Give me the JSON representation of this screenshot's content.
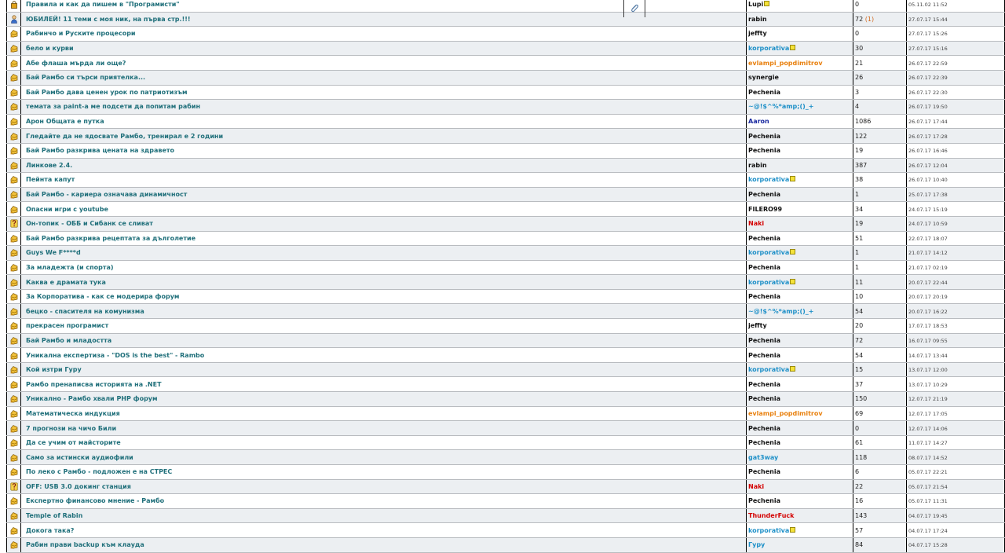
{
  "colors": {
    "title_link": "#1f6f7a",
    "row_alt": "#eceff2",
    "author_default": "#111111",
    "author_blue": "#1e90c8",
    "author_orange": "#e8800e",
    "author_red": "#d40000",
    "author_navy": "#1a2aa0"
  },
  "topics": [
    {
      "icon": "lock-icon",
      "title": "Правила и как да пишем в \"Програмисти\"",
      "author": "Lupi",
      "author_color": "#111111",
      "badge": true,
      "replies": "0",
      "new_replies": "",
      "date": "05.11.02 11:52"
    },
    {
      "icon": "user-icon",
      "title": "ЮБИЛЕЙ! 11 теми с моя ник, на първа стр.!!!",
      "author": "rabin",
      "author_color": "#111111",
      "badge": false,
      "replies": "72",
      "new_replies": "(1)",
      "date": "27.07.17 15:44"
    },
    {
      "icon": "thread-icon",
      "title": "Рабинчо и Руските процесори",
      "author": "jeffty",
      "author_color": "#111111",
      "badge": false,
      "replies": "0",
      "new_replies": "",
      "date": "27.07.17 15:26"
    },
    {
      "icon": "thread-icon",
      "title": "бело и курви",
      "author": "korporativa",
      "author_color": "#1e90c8",
      "badge": true,
      "replies": "30",
      "new_replies": "",
      "date": "27.07.17 15:16"
    },
    {
      "icon": "thread-icon",
      "title": "Абе флаша мърда ли още?",
      "author": "evlampi_popdimitrov",
      "author_color": "#e8800e",
      "badge": false,
      "replies": "21",
      "new_replies": "",
      "date": "26.07.17 22:59"
    },
    {
      "icon": "thread-icon",
      "title": "Бай Рамбо си търси приятелка...",
      "author": "synergie",
      "author_color": "#111111",
      "badge": false,
      "replies": "26",
      "new_replies": "",
      "date": "26.07.17 22:39"
    },
    {
      "icon": "thread-icon",
      "title": "Бай Рамбо дава ценен урок по патриотизъм",
      "author": "Pechenia",
      "author_color": "#111111",
      "badge": false,
      "replies": "3",
      "new_replies": "",
      "date": "26.07.17 22:30"
    },
    {
      "icon": "thread-icon",
      "title": "темата за paint-a ме подсети да попитам рабин",
      "author": "~@!$^%*amp;()_+",
      "author_color": "#1e90c8",
      "badge": false,
      "replies": "4",
      "new_replies": "",
      "date": "26.07.17 19:50"
    },
    {
      "icon": "thread-icon",
      "title": "Арон Общата е путка",
      "author": "Aaron",
      "author_color": "#1a2aa0",
      "badge": false,
      "replies": "1086",
      "new_replies": "",
      "date": "26.07.17 17:44"
    },
    {
      "icon": "thread-icon",
      "title": "Гледайте да не ядосвате Рамбо, тренирал е 2 години",
      "author": "Pechenia",
      "author_color": "#111111",
      "badge": false,
      "replies": "122",
      "new_replies": "",
      "date": "26.07.17 17:28"
    },
    {
      "icon": "thread-icon",
      "title": "Бай Рамбо разкрива цената на здравето",
      "author": "Pechenia",
      "author_color": "#111111",
      "badge": false,
      "replies": "19",
      "new_replies": "",
      "date": "26.07.17 16:46"
    },
    {
      "icon": "thread-icon",
      "title": "Линкове 2.4.",
      "author": "rabin",
      "author_color": "#111111",
      "badge": false,
      "replies": "387",
      "new_replies": "",
      "date": "26.07.17 12:04"
    },
    {
      "icon": "thread-icon",
      "title": "Пейнта капут",
      "author": "korporativa",
      "author_color": "#1e90c8",
      "badge": true,
      "replies": "38",
      "new_replies": "",
      "date": "26.07.17 10:40"
    },
    {
      "icon": "thread-icon",
      "title": "Бай Рамбо - кариера означава динамичност",
      "author": "Pechenia",
      "author_color": "#111111",
      "badge": false,
      "replies": "1",
      "new_replies": "",
      "date": "25.07.17 17:38"
    },
    {
      "icon": "thread-icon",
      "title": "Опасни игри с youtube",
      "author": "FILERO99",
      "author_color": "#111111",
      "badge": false,
      "replies": "34",
      "new_replies": "",
      "date": "24.07.17 15:19"
    },
    {
      "icon": "question-icon",
      "title": "Он-топик - ОББ и Сибанк се сливат",
      "author": "Naki",
      "author_color": "#d40000",
      "badge": false,
      "replies": "19",
      "new_replies": "",
      "date": "24.07.17 10:59"
    },
    {
      "icon": "thread-icon",
      "title": "Бай Рамбо разкрива рецептата за дълголетие",
      "author": "Pechenia",
      "author_color": "#111111",
      "badge": false,
      "replies": "51",
      "new_replies": "",
      "date": "22.07.17 18:07"
    },
    {
      "icon": "thread-icon",
      "title": "Guys We F****d",
      "author": "korporativa",
      "author_color": "#1e90c8",
      "badge": true,
      "replies": "1",
      "new_replies": "",
      "date": "21.07.17 14:12"
    },
    {
      "icon": "thread-icon",
      "title": "За младежта (и спорта)",
      "author": "Pechenia",
      "author_color": "#111111",
      "badge": false,
      "replies": "1",
      "new_replies": "",
      "date": "21.07.17 02:19"
    },
    {
      "icon": "thread-icon",
      "title": "Каква е драмата тука",
      "author": "korporativa",
      "author_color": "#1e90c8",
      "badge": true,
      "replies": "11",
      "new_replies": "",
      "date": "20.07.17 22:44"
    },
    {
      "icon": "thread-icon",
      "title": "За Корпоратива - как се модерира форум",
      "author": "Pechenia",
      "author_color": "#111111",
      "badge": false,
      "replies": "10",
      "new_replies": "",
      "date": "20.07.17 20:19"
    },
    {
      "icon": "thread-icon",
      "title": "бецко - спасителя на комунизма",
      "author": "~@!$^%*amp;()_+",
      "author_color": "#1e90c8",
      "badge": false,
      "replies": "54",
      "new_replies": "",
      "date": "20.07.17 16:22"
    },
    {
      "icon": "thread-icon",
      "title": "прекрасен програмист",
      "author": "jeffty",
      "author_color": "#111111",
      "badge": false,
      "replies": "20",
      "new_replies": "",
      "date": "17.07.17 18:53"
    },
    {
      "icon": "thread-icon",
      "title": "Бай Рамбо и младостта",
      "author": "Pechenia",
      "author_color": "#111111",
      "badge": false,
      "replies": "72",
      "new_replies": "",
      "date": "16.07.17 09:55"
    },
    {
      "icon": "thread-icon",
      "title": "Уникална експертиза - \"DOS is the best\" - Rambo",
      "author": "Pechenia",
      "author_color": "#111111",
      "badge": false,
      "replies": "54",
      "new_replies": "",
      "date": "14.07.17 13:44"
    },
    {
      "icon": "thread-icon",
      "title": "Кой изтри Гуру",
      "author": "korporativa",
      "author_color": "#1e90c8",
      "badge": true,
      "replies": "15",
      "new_replies": "",
      "date": "13.07.17 12:00"
    },
    {
      "icon": "thread-icon",
      "title": "Рамбо пренаписва историята на .NET",
      "author": "Pechenia",
      "author_color": "#111111",
      "badge": false,
      "replies": "37",
      "new_replies": "",
      "date": "13.07.17 10:29"
    },
    {
      "icon": "thread-icon",
      "title": "Уникално - Рамбо хвали PHP форум",
      "author": "Pechenia",
      "author_color": "#111111",
      "badge": false,
      "replies": "150",
      "new_replies": "",
      "date": "12.07.17 21:19"
    },
    {
      "icon": "thread-icon",
      "title": "Математическа индукция",
      "author": "evlampi_popdimitrov",
      "author_color": "#e8800e",
      "badge": false,
      "replies": "69",
      "new_replies": "",
      "date": "12.07.17 17:05"
    },
    {
      "icon": "thread-icon",
      "title": "7 прогнози на чичо Били",
      "author": "Pechenia",
      "author_color": "#111111",
      "badge": false,
      "replies": "0",
      "new_replies": "",
      "date": "12.07.17 14:06"
    },
    {
      "icon": "thread-icon",
      "title": "Да се учим от майсторите",
      "author": "Pechenia",
      "author_color": "#111111",
      "badge": false,
      "replies": "61",
      "new_replies": "",
      "date": "11.07.17 14:27"
    },
    {
      "icon": "thread-icon",
      "title": "Само за истински аудиофили",
      "author": "gat3way",
      "author_color": "#1e90c8",
      "badge": false,
      "replies": "118",
      "new_replies": "",
      "date": "08.07.17 14:52"
    },
    {
      "icon": "thread-icon",
      "title": "По леко с Рамбо - подложен е на СТРЕС",
      "author": "Pechenia",
      "author_color": "#111111",
      "badge": false,
      "replies": "6",
      "new_replies": "",
      "date": "05.07.17 22:21"
    },
    {
      "icon": "question-icon",
      "title": "OFF: USB 3.0 докинг станция",
      "author": "Naki",
      "author_color": "#d40000",
      "badge": false,
      "replies": "22",
      "new_replies": "",
      "date": "05.07.17 21:54"
    },
    {
      "icon": "thread-icon",
      "title": "Експертно финансово мнение - Рамбо",
      "author": "Pechenia",
      "author_color": "#111111",
      "badge": false,
      "replies": "16",
      "new_replies": "",
      "date": "05.07.17 11:31"
    },
    {
      "icon": "thread-icon",
      "title": "Temple of Rabin",
      "author": "ThunderFuck",
      "author_color": "#d40000",
      "badge": false,
      "replies": "143",
      "new_replies": "",
      "date": "04.07.17 19:45"
    },
    {
      "icon": "thread-icon",
      "title": "Докога така?",
      "author": "korporativa",
      "author_color": "#1e90c8",
      "badge": true,
      "replies": "57",
      "new_replies": "",
      "date": "04.07.17 17:24"
    },
    {
      "icon": "thread-icon",
      "title": "Рабин прави backup към клауда",
      "author": "Гуру",
      "author_color": "#1e90c8",
      "badge": false,
      "replies": "84",
      "new_replies": "",
      "date": "04.07.17 15:28"
    }
  ]
}
